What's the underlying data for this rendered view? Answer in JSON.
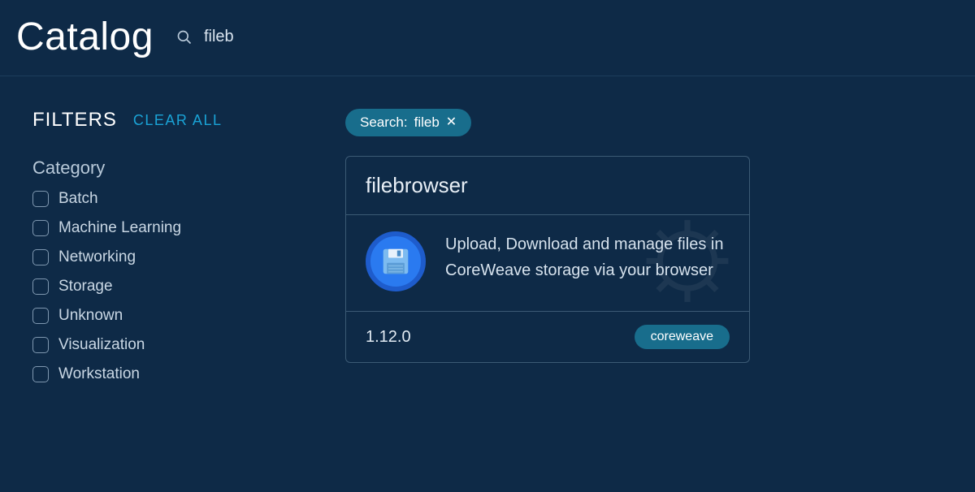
{
  "header": {
    "title": "Catalog",
    "search_value": "fileb"
  },
  "filters": {
    "label": "FILTERS",
    "clear_all": "CLEAR ALL",
    "category_label": "Category",
    "categories": [
      "Batch",
      "Machine Learning",
      "Networking",
      "Storage",
      "Unknown",
      "Visualization",
      "Workstation"
    ]
  },
  "chip": {
    "prefix": "Search: ",
    "value": "fileb"
  },
  "card": {
    "title": "filebrowser",
    "description": "Upload, Download and manage files in CoreWeave storage via your browser",
    "version": "1.12.0",
    "tag": "coreweave"
  }
}
